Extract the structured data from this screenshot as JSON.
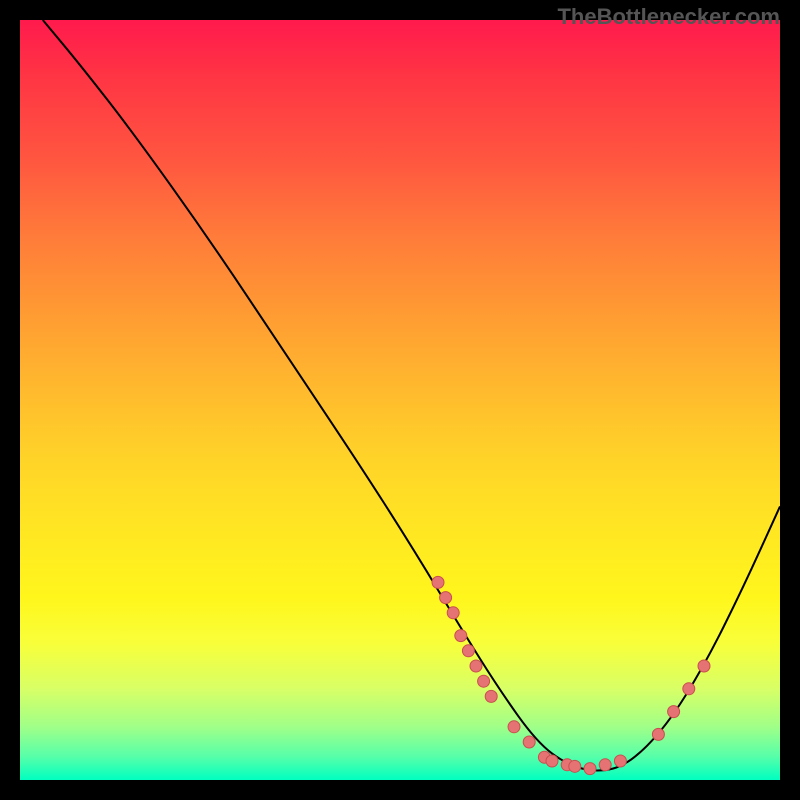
{
  "watermark": "TheBottlenecker.com",
  "chart_data": {
    "type": "line",
    "title": "",
    "xlabel": "",
    "ylabel": "",
    "xlim": [
      0,
      100
    ],
    "ylim": [
      0,
      100
    ],
    "gradient_meaning": "background color maps bottleneck severity (red=high, green=low)",
    "curve": [
      {
        "x": 3,
        "y": 100
      },
      {
        "x": 8,
        "y": 94
      },
      {
        "x": 15,
        "y": 85
      },
      {
        "x": 25,
        "y": 71
      },
      {
        "x": 35,
        "y": 56
      },
      {
        "x": 45,
        "y": 41
      },
      {
        "x": 52,
        "y": 30
      },
      {
        "x": 58,
        "y": 20
      },
      {
        "x": 63,
        "y": 12
      },
      {
        "x": 68,
        "y": 5
      },
      {
        "x": 72,
        "y": 2
      },
      {
        "x": 76,
        "y": 1
      },
      {
        "x": 80,
        "y": 2
      },
      {
        "x": 85,
        "y": 7
      },
      {
        "x": 90,
        "y": 15
      },
      {
        "x": 95,
        "y": 25
      },
      {
        "x": 100,
        "y": 36
      }
    ],
    "markers": [
      {
        "x": 55,
        "y": 26
      },
      {
        "x": 56,
        "y": 24
      },
      {
        "x": 57,
        "y": 22
      },
      {
        "x": 58,
        "y": 19
      },
      {
        "x": 59,
        "y": 17
      },
      {
        "x": 60,
        "y": 15
      },
      {
        "x": 61,
        "y": 13
      },
      {
        "x": 62,
        "y": 11
      },
      {
        "x": 65,
        "y": 7
      },
      {
        "x": 67,
        "y": 5
      },
      {
        "x": 69,
        "y": 3
      },
      {
        "x": 70,
        "y": 2.5
      },
      {
        "x": 72,
        "y": 2
      },
      {
        "x": 73,
        "y": 1.8
      },
      {
        "x": 75,
        "y": 1.5
      },
      {
        "x": 77,
        "y": 2
      },
      {
        "x": 79,
        "y": 2.5
      },
      {
        "x": 84,
        "y": 6
      },
      {
        "x": 86,
        "y": 9
      },
      {
        "x": 88,
        "y": 12
      },
      {
        "x": 90,
        "y": 15
      }
    ],
    "marker_style": {
      "fill": "#e57373",
      "stroke": "#c94f4f",
      "r": 6
    }
  }
}
